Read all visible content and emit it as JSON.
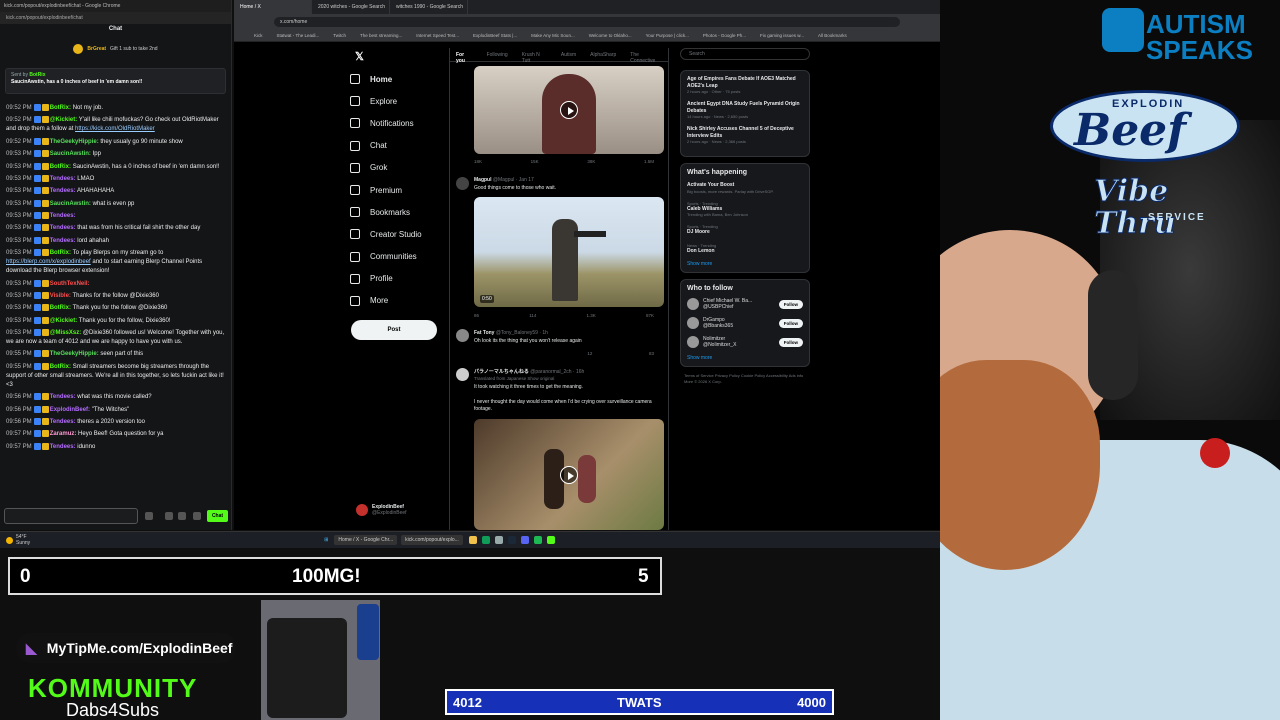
{
  "chat": {
    "window_title": "kick.com/popout/explodinbeef/chat - Google Chrome",
    "url": "kick.com/popout/explodinbeef/chat",
    "header": "Chat",
    "gift_user": "BrGreat",
    "gift_text": "Gift 1 sub to take 2nd",
    "pinned_sent_by": "Sent by",
    "pinned_user": "BotRix",
    "pinned_message": "SaucinAwstin, has a 0 inches of beef in 'em damn son!!",
    "send_label": "Chat",
    "messages": [
      {
        "time": "09:52 PM",
        "user": "BotRix:",
        "ucolor": "#53fc18",
        "text": "Not my job."
      },
      {
        "time": "09:52 PM",
        "user": "@Kickiet:",
        "ucolor": "#53fc18",
        "text": "Y'all like chili mofuckas? Go check out OldRiotMaker and drop them a follow at ",
        "link": "https://kick.com/OldRiotMaker"
      },
      {
        "time": "09:52 PM",
        "user": "TheGeekyHippie:",
        "ucolor": "#56e05a",
        "text": "they usualy go 90 minute show"
      },
      {
        "time": "09:53 PM",
        "user": "SaucinAwstin:",
        "ucolor": "#56e05a",
        "text": "Ipp"
      },
      {
        "time": "09:53 PM",
        "user": "BotRix:",
        "ucolor": "#53fc18",
        "text": "SaucinAwstin, has a 0 inches of beef in 'em damn son!!"
      },
      {
        "time": "09:53 PM",
        "user": "Tendees:",
        "ucolor": "#b36bff",
        "text": "LMAO"
      },
      {
        "time": "09:53 PM",
        "user": "Tendees:",
        "ucolor": "#b36bff",
        "text": "AHAHAHAHA"
      },
      {
        "time": "09:53 PM",
        "user": "SaucinAwstin:",
        "ucolor": "#56e05a",
        "text": "what is even pp"
      },
      {
        "time": "09:53 PM",
        "user": "Tendees:",
        "ucolor": "#b36bff",
        "text": ""
      },
      {
        "time": "09:53 PM",
        "user": "Tendees:",
        "ucolor": "#b36bff",
        "text": "that was from his critical fail shirt the other day"
      },
      {
        "time": "09:53 PM",
        "user": "Tendees:",
        "ucolor": "#b36bff",
        "text": "lord ahahah"
      },
      {
        "time": "09:53 PM",
        "user": "BotRix:",
        "ucolor": "#53fc18",
        "text": "To play Blerps on my stream go to ",
        "link": "https://blerp.com/x/explodinbeef",
        "after": " and to start earning Blerp Channel Points download the Blerp browser extension!"
      },
      {
        "time": "09:53 PM",
        "user": "SouthTexNeil:",
        "ucolor": "#ff4d4d",
        "text": ""
      },
      {
        "time": "09:53 PM",
        "user": "Visible:",
        "ucolor": "#ff4d4d",
        "text": "Thanks for the follow @Dixie360"
      },
      {
        "time": "09:53 PM",
        "user": "BotRix:",
        "ucolor": "#53fc18",
        "text": "Thank you for the follow @Dixie360"
      },
      {
        "time": "09:53 PM",
        "user": "@Kickiet:",
        "ucolor": "#53fc18",
        "text": "Thank you for the follow, Dixie360!"
      },
      {
        "time": "09:53 PM",
        "user": "@MissXsz:",
        "ucolor": "#53fc18",
        "text": "@Dixie360 followed us! Welcome! Together with you, we are now a team of 4012 and we are happy to have you with us."
      },
      {
        "time": "09:55 PM",
        "user": "TheGeekyHippie:",
        "ucolor": "#56e05a",
        "text": "seen part of this"
      },
      {
        "time": "09:55 PM",
        "user": "BotRix:",
        "ucolor": "#53fc18",
        "text": "Small streamers become big streamers through the support of other small streamers. We're all in this together, so lets fuckin act like it! <3"
      },
      {
        "time": "09:56 PM",
        "user": "Tendees:",
        "ucolor": "#b36bff",
        "text": "what was this movie called?"
      },
      {
        "time": "09:56 PM",
        "user": "ExplodinBeef:",
        "ucolor": "#b36bff",
        "text": "\"The Witches\""
      },
      {
        "time": "09:56 PM",
        "user": "Tendees:",
        "ucolor": "#b36bff",
        "text": "theres a 2020 version too"
      },
      {
        "time": "09:57 PM",
        "user": "Zaramuz:",
        "ucolor": "#ff9ad5",
        "text": "Heyo Beef! Gota question for ya"
      },
      {
        "time": "09:57 PM",
        "user": "Tendees:",
        "ucolor": "#b36bff",
        "text": "idunno"
      }
    ]
  },
  "browser": {
    "tabs": [
      "Home / X",
      "2020 witches - Google Search",
      "witches 1990 - Google Search"
    ],
    "url": "x.com/home",
    "bookmarks": [
      "Kick",
      "Statwat - The Leadi...",
      "Twitch",
      "The best streaming...",
      "Internet Speed Test...",
      "ExplodinBeef Stats |...",
      "Make Any Mic Soun...",
      "Welcome to Oklaho...",
      "Your Purpose | click...",
      "Photos - Google Ph...",
      "Fix gaming issues w..."
    ],
    "bookmarks_all": "All Bookmarks"
  },
  "x": {
    "nav": [
      "Home",
      "Explore",
      "Notifications",
      "Chat",
      "Grok",
      "Premium",
      "Bookmarks",
      "Creator Studio",
      "Communities",
      "Profile",
      "More"
    ],
    "post": "Post",
    "profile_name": "ExplodinBeef",
    "profile_handle": "@ExplodinBeef",
    "feed_tabs": [
      "For you",
      "Following",
      "Krush N Tutt",
      "Autism",
      "AlphaSharp",
      "The Connective"
    ],
    "tweets": [
      {
        "name": "",
        "meta": "",
        "text": "",
        "stats": [
          "18K",
          "15K",
          "38K",
          "1.5M"
        ]
      },
      {
        "name": "Magpul",
        "meta": "@Magpul · Jan 17",
        "text": "Good things come to those who wait.",
        "duration": "0:50",
        "stats": [
          "86",
          "114",
          "1.3K",
          "87K"
        ]
      },
      {
        "name": "Fat Tony",
        "meta": "@Tony_Baloney59 · 1h",
        "text": "Oh look its the thing that you won't release again",
        "stats": [
          "",
          "",
          "12",
          "83"
        ]
      },
      {
        "name": "パラノーマルちゃんねる",
        "meta": "@paranormal_2ch · 16h",
        "translated": "Translated from Japanese Show original",
        "text": "It took watching it three times to get the meaning.",
        "text2": "I never thought the day would come when I'd be crying over surveillance camera footage."
      }
    ],
    "search_placeholder": "Search",
    "news": [
      {
        "title": "Age of Empires Fans Debate If AOE3 Matched AOE2's Leap",
        "sub": "2 hours ago · Other · 75 posts"
      },
      {
        "title": "Ancient Egypt DNA Study Fuels Pyramid Origin Debates",
        "sub": "14 hours ago · News · 2,650 posts"
      },
      {
        "title": "Nick Shirley Accuses Channel 5 of Deceptive Interview Edits",
        "sub": "2 hours ago · News · 2,366 posts"
      }
    ],
    "whats_happening": "What's happening",
    "trends": [
      {
        "pre": "",
        "title": "Activate Your Boost",
        "sub": "Big boosts, more rewards. Parlay with DriveSGP."
      },
      {
        "pre": "Sports · Trending",
        "title": "Caleb Williams",
        "sub": "Trending with Bama, Ben Johnson"
      },
      {
        "pre": "Sports · Trending",
        "title": "DJ Moore",
        "sub": ""
      },
      {
        "pre": "News · Trending",
        "title": "Don Lemon",
        "sub": ""
      }
    ],
    "show_more": "Show more",
    "who_to_follow": "Who to follow",
    "follows": [
      {
        "name": "Chief Michael W. Ba...",
        "handle": "@USBPChief"
      },
      {
        "name": "DrGampo",
        "handle": "@Bbanks365"
      },
      {
        "name": "Nolimitzer",
        "handle": "@Nolimitzer_X"
      }
    ],
    "follow_label": "Follow",
    "footer": "Terms of Service  Privacy Policy  Cookie Policy  Accessibility  Ads info  More  © 2026 X Corp."
  },
  "taskbar": {
    "weather_temp": "54°F",
    "weather_text": "Sunny",
    "apps": [
      "Home / X - Google Chr...",
      "kick.com/popout/explo..."
    ]
  },
  "overlay": {
    "score_left": "0",
    "score_title": "100MG!",
    "score_right": "5",
    "tip_text": "MyTipMe.com/ExplodinBeef",
    "community": "KOMMUNITY",
    "dabs": "Dabs4Subs",
    "goal_current": "4012",
    "goal_label": "TWATS",
    "goal_target": "4000",
    "autism_line1": "AUTISM",
    "autism_line2": "SPEAKS",
    "sign_line1": "EXPLODIN",
    "sign_line2": "Beef",
    "sign_line3": "Vibe Thru",
    "sign_line4": "SERVICE"
  },
  "colors": {
    "kick_green": "#53fc18",
    "x_blue": "#1d9bf0",
    "goal_blue": "#1630b8"
  }
}
